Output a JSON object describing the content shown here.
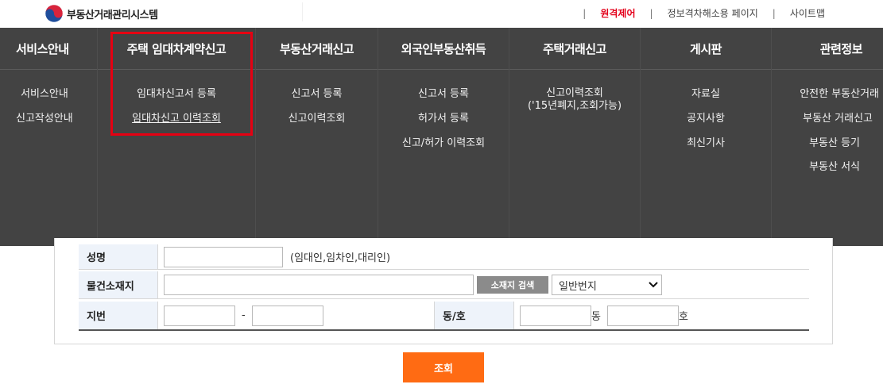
{
  "header": {
    "logo_text": "부동산거래관리시스템",
    "util_links": [
      {
        "label": "원격제어"
      },
      {
        "label": "정보격차해소용 페이지"
      },
      {
        "label": "사이트맵"
      }
    ],
    "separator": "|"
  },
  "gnb": {
    "menus": [
      {
        "title": "서비스안내",
        "items": [
          "서비스안내",
          "신고작성안내"
        ]
      },
      {
        "title": "주택 임대차계약신고",
        "items": [
          "임대차신고서 등록",
          "임대차신고 이력조회"
        ]
      },
      {
        "title": "부동산거래신고",
        "items": [
          "신고서 등록",
          "신고이력조회"
        ]
      },
      {
        "title": "외국인부동산취득",
        "items": [
          "신고서 등록",
          "허가서 등록",
          "신고/허가 이력조회"
        ]
      },
      {
        "title": "주택거래신고",
        "items": [
          "신고이력조회",
          "('15년폐지,조회가능)"
        ]
      },
      {
        "title": "게시판",
        "items": [
          "자료실",
          "공지사항",
          "최신기사"
        ]
      },
      {
        "title": "관련정보",
        "items": [
          "안전한 부동산거래",
          "부동산 거래신고",
          "부동산 등기",
          "부동산 서식"
        ]
      }
    ]
  },
  "form": {
    "name_label": "성명",
    "name_hint": "(임대인,임차인,대리인)",
    "address_label": "물건소재지",
    "address_search_button": "소재지 검색",
    "address_type_selected": "일반번지",
    "lot_label": "지번",
    "lot_separator": "-",
    "dong_ho_label": "동/호",
    "dong_unit": "동",
    "ho_unit": "호",
    "submit_label": "조회"
  },
  "colors": {
    "gnb_bg": "#434343",
    "highlight": "#e60012",
    "accent": "#ff6b13",
    "header_cell_bg": "#eef3fa",
    "remote_link": "#e3001b"
  }
}
